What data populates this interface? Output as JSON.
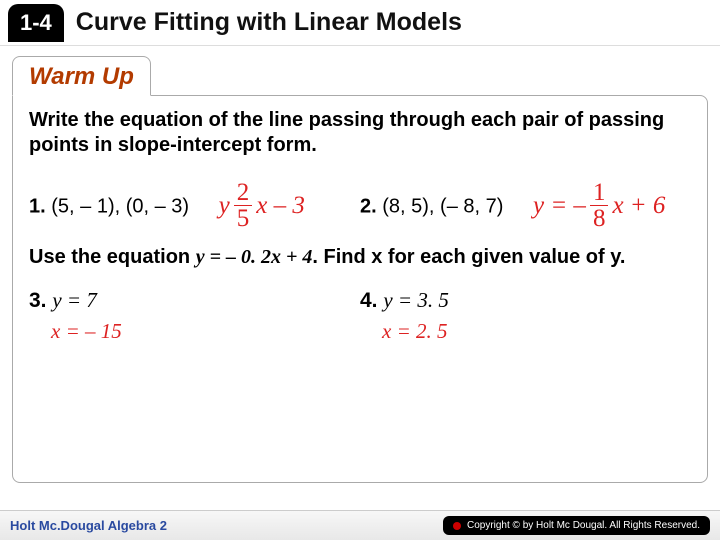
{
  "header": {
    "chapter": "1-4",
    "title": "Curve Fitting with Linear Models"
  },
  "section": {
    "label": "Warm Up"
  },
  "instructions1": "Write the equation of the line passing through each pair of passing points in slope-intercept form.",
  "problem1": {
    "label": "1.",
    "points": "(5, – 1), (0, – 3)",
    "answer_y": "y",
    "frac_num": "2",
    "frac_den": "5",
    "tail": "x – 3"
  },
  "problem2": {
    "label": "2.",
    "points": "(8, 5), (– 8, 7)",
    "answer_pre": "y = –",
    "frac_num": "1",
    "frac_den": "8",
    "tail": "x + 6"
  },
  "instructions2_pre": "Use the equation ",
  "instructions2_eq": "y = – 0. 2x + 4",
  "instructions2_post": ". Find x for each given value of y.",
  "problem3": {
    "label": "3.",
    "given": "y = 7",
    "answer": "x = – 15"
  },
  "problem4": {
    "label": "4.",
    "given": "y = 3. 5",
    "answer": "x = 2. 5"
  },
  "footer": {
    "book": "Holt Mc.Dougal Algebra 2",
    "copyright": "Copyright © by Holt Mc Dougal. All Rights Reserved."
  }
}
